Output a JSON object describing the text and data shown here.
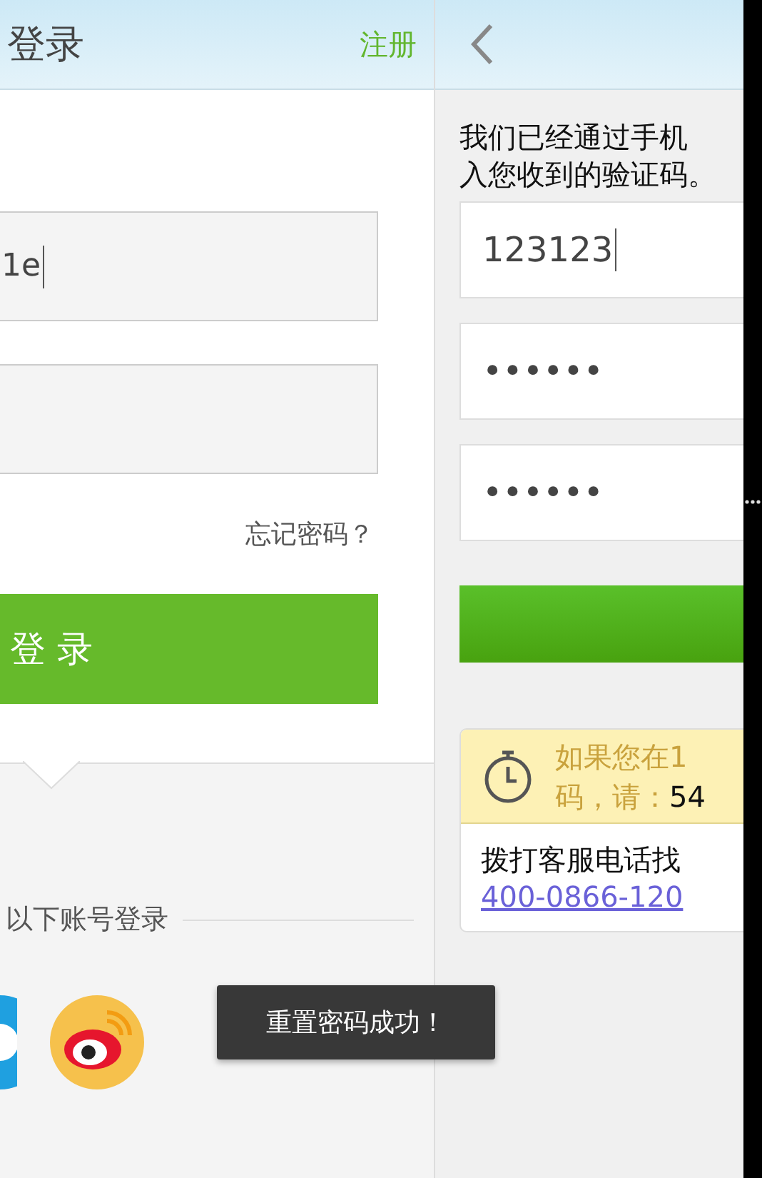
{
  "login": {
    "title": "登录",
    "register_link": "注册",
    "username_field": {
      "value": "1e",
      "focused": true
    },
    "forgot_link": "忘记密码？",
    "login_button": "登 录",
    "social_heading": "以下账号登录"
  },
  "reset": {
    "message_lines": [
      "我们已经通过手机",
      "入您收到的验证码。"
    ],
    "fields": [
      {
        "value": "123123",
        "focused": true
      },
      {
        "value": "••••••",
        "focused": false
      },
      {
        "value": "••••••",
        "focused": false
      }
    ],
    "notice": {
      "line_1": "如果您在1",
      "line_2": "码，请：",
      "countdown": "54"
    },
    "help": {
      "text": "拨打客服电话找",
      "phone": "400-0866-120"
    }
  },
  "toast": "重置密码成功！"
}
